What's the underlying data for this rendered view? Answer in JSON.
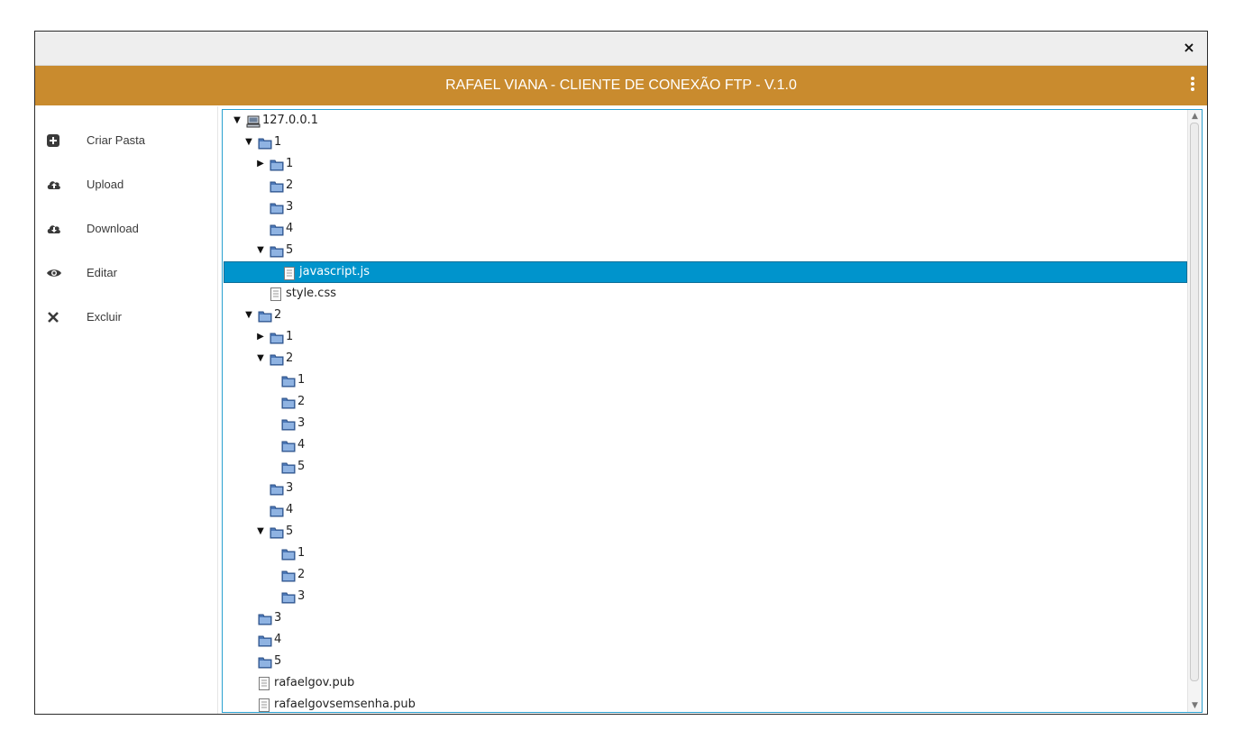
{
  "window": {
    "close_label": "×"
  },
  "header": {
    "title": "RAFAEL VIANA - CLIENTE DE CONEXÃO FTP - V.1.0",
    "color": "#c98b2e"
  },
  "sidebar": {
    "items": [
      {
        "name": "create-folder",
        "icon": "plus-square-icon",
        "label": "Criar Pasta"
      },
      {
        "name": "upload",
        "icon": "cloud-upload-icon",
        "label": "Upload"
      },
      {
        "name": "download",
        "icon": "cloud-download-icon",
        "label": "Download"
      },
      {
        "name": "edit",
        "icon": "eye-icon",
        "label": "Editar"
      },
      {
        "name": "delete",
        "icon": "x-icon",
        "label": "Excluir"
      }
    ]
  },
  "tree": {
    "selected_color": "#0094cc",
    "rows": [
      {
        "depth": 0,
        "type": "server",
        "expand": "open",
        "label": "127.0.0.1"
      },
      {
        "depth": 1,
        "type": "folder",
        "expand": "open",
        "label": "1"
      },
      {
        "depth": 2,
        "type": "folder",
        "expand": "closed",
        "label": "1"
      },
      {
        "depth": 2,
        "type": "folder",
        "expand": "none",
        "label": "2"
      },
      {
        "depth": 2,
        "type": "folder",
        "expand": "none",
        "label": "3"
      },
      {
        "depth": 2,
        "type": "folder",
        "expand": "none",
        "label": "4"
      },
      {
        "depth": 2,
        "type": "folder",
        "expand": "open",
        "label": "5"
      },
      {
        "depth": 3,
        "type": "file",
        "expand": "none",
        "label": "javascript.js",
        "selected": true
      },
      {
        "depth": 2,
        "type": "file",
        "expand": "none",
        "label": "style.css"
      },
      {
        "depth": 1,
        "type": "folder",
        "expand": "open",
        "label": "2"
      },
      {
        "depth": 2,
        "type": "folder",
        "expand": "closed",
        "label": "1"
      },
      {
        "depth": 2,
        "type": "folder",
        "expand": "open",
        "label": "2"
      },
      {
        "depth": 3,
        "type": "folder",
        "expand": "none",
        "label": "1"
      },
      {
        "depth": 3,
        "type": "folder",
        "expand": "none",
        "label": "2"
      },
      {
        "depth": 3,
        "type": "folder",
        "expand": "none",
        "label": "3"
      },
      {
        "depth": 3,
        "type": "folder",
        "expand": "none",
        "label": "4"
      },
      {
        "depth": 3,
        "type": "folder",
        "expand": "none",
        "label": "5"
      },
      {
        "depth": 2,
        "type": "folder",
        "expand": "none",
        "label": "3"
      },
      {
        "depth": 2,
        "type": "folder",
        "expand": "none",
        "label": "4"
      },
      {
        "depth": 2,
        "type": "folder",
        "expand": "open",
        "label": "5"
      },
      {
        "depth": 3,
        "type": "folder",
        "expand": "none",
        "label": "1"
      },
      {
        "depth": 3,
        "type": "folder",
        "expand": "none",
        "label": "2"
      },
      {
        "depth": 3,
        "type": "folder",
        "expand": "none",
        "label": "3"
      },
      {
        "depth": 1,
        "type": "folder",
        "expand": "none",
        "label": "3"
      },
      {
        "depth": 1,
        "type": "folder",
        "expand": "none",
        "label": "4"
      },
      {
        "depth": 1,
        "type": "folder",
        "expand": "none",
        "label": "5"
      },
      {
        "depth": 1,
        "type": "file",
        "expand": "none",
        "label": "rafaelgov.pub"
      },
      {
        "depth": 1,
        "type": "file",
        "expand": "none",
        "label": "rafaelgovsemsenha.pub"
      }
    ]
  }
}
